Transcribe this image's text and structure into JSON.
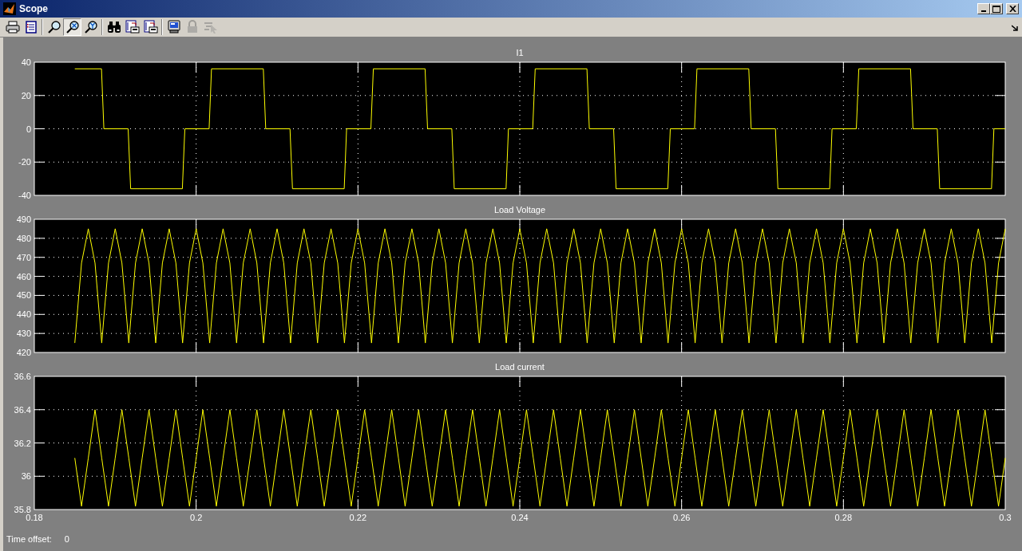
{
  "window": {
    "title": "Scope"
  },
  "toolbar": [
    {
      "kind": "print",
      "selected": false,
      "disabled": false
    },
    {
      "kind": "parameters",
      "selected": false,
      "disabled": false
    },
    {
      "kind": "separator"
    },
    {
      "kind": "zoom",
      "selected": false,
      "disabled": false
    },
    {
      "kind": "zoom-x",
      "selected": true,
      "disabled": false
    },
    {
      "kind": "zoom-y",
      "selected": false,
      "disabled": false
    },
    {
      "kind": "separator"
    },
    {
      "kind": "autoscale",
      "selected": false,
      "disabled": false
    },
    {
      "kind": "save-axes",
      "selected": false,
      "disabled": false
    },
    {
      "kind": "restore-axes",
      "selected": false,
      "disabled": false
    },
    {
      "kind": "separator"
    },
    {
      "kind": "floating",
      "selected": false,
      "disabled": false
    },
    {
      "kind": "lock",
      "selected": false,
      "disabled": true
    },
    {
      "kind": "signal-select",
      "selected": false,
      "disabled": true
    }
  ],
  "plots": [
    {
      "chart_data": {
        "type": "line",
        "title": "I1",
        "xlim": [
          0.18,
          0.3
        ],
        "ylim": [
          -40,
          40
        ],
        "yticks": [
          -40,
          -20,
          0,
          20,
          40
        ],
        "grid": true,
        "x": [
          0.185,
          0.1883,
          0.1886,
          0.1916,
          0.1919,
          0.1983,
          0.1986,
          0.2016,
          0.2019,
          0.2083,
          0.2086,
          0.2116,
          0.2119,
          0.2183,
          0.2186,
          0.2216,
          0.2219,
          0.2283,
          0.2286,
          0.2316,
          0.2319,
          0.2383,
          0.2386,
          0.2416,
          0.2419,
          0.2483,
          0.2486,
          0.2516,
          0.2519,
          0.2583,
          0.2586,
          0.2616,
          0.2619,
          0.2683,
          0.2686,
          0.2716,
          0.2719,
          0.2783,
          0.2786,
          0.2816,
          0.2819,
          0.2883,
          0.2886,
          0.2916,
          0.2919,
          0.2983,
          0.2986,
          0.3
        ],
        "series": [
          {
            "color": "#ffff00",
            "values": [
              36,
              36,
              0,
              0,
              -36,
              -36,
              0,
              0,
              36,
              36,
              0,
              0,
              -36,
              -36,
              0,
              0,
              36,
              36,
              0,
              0,
              -36,
              -36,
              0,
              0,
              36,
              36,
              0,
              0,
              -36,
              -36,
              0,
              0,
              36,
              36,
              0,
              0,
              -36,
              -36,
              0,
              0,
              36,
              36,
              0,
              0,
              -36,
              -36,
              0,
              0
            ]
          }
        ]
      }
    },
    {
      "chart_data": {
        "type": "line",
        "title": "Load Voltage",
        "xlim": [
          0.18,
          0.3
        ],
        "ylim": [
          420,
          490
        ],
        "yticks": [
          420,
          430,
          440,
          450,
          460,
          470,
          480,
          490
        ],
        "grid": true,
        "x": [
          0.185,
          0.18583,
          0.18667,
          0.1875,
          0.18833,
          0.18917,
          0.19,
          0.19083,
          0.19167,
          0.1925,
          0.19333,
          0.19417,
          0.195,
          0.19583,
          0.19667,
          0.1975,
          0.19833,
          0.19917,
          0.2,
          0.20083,
          0.20167,
          0.2025,
          0.20333,
          0.20417,
          0.205,
          0.20583,
          0.20667,
          0.2075,
          0.20833,
          0.20917,
          0.21,
          0.21083,
          0.21167,
          0.2125,
          0.21333,
          0.21417,
          0.215,
          0.21583,
          0.21667,
          0.2175,
          0.21833,
          0.21917,
          0.22,
          0.22083,
          0.22167,
          0.2225,
          0.22333,
          0.22417,
          0.225,
          0.22583,
          0.22667,
          0.2275,
          0.22833,
          0.22917,
          0.23,
          0.23083,
          0.23167,
          0.2325,
          0.23333,
          0.23417,
          0.235,
          0.23583,
          0.23667,
          0.2375,
          0.23833,
          0.23917,
          0.24,
          0.24083,
          0.24167,
          0.2425,
          0.24333,
          0.24417,
          0.245,
          0.24583,
          0.24667,
          0.2475,
          0.24833,
          0.24917,
          0.25,
          0.25083,
          0.25167,
          0.2525,
          0.25333,
          0.25417,
          0.255,
          0.25583,
          0.25667,
          0.2575,
          0.25833,
          0.25917,
          0.26,
          0.26083,
          0.26167,
          0.2625,
          0.26333,
          0.26417,
          0.265,
          0.26583,
          0.26667,
          0.2675,
          0.26833,
          0.26917,
          0.27,
          0.27083,
          0.27167,
          0.2725,
          0.27333,
          0.27417,
          0.275,
          0.27583,
          0.27667,
          0.2775,
          0.27833,
          0.27917,
          0.28,
          0.28083,
          0.28167,
          0.2825,
          0.28333,
          0.28417,
          0.285,
          0.28583,
          0.28667,
          0.2875,
          0.28833,
          0.28917,
          0.29,
          0.29083,
          0.29167,
          0.2925,
          0.29333,
          0.29417,
          0.295,
          0.29583,
          0.29667,
          0.2975,
          0.29833,
          0.29917,
          0.3
        ],
        "series": [
          {
            "color": "#ffff00",
            "values": [
              425,
              467,
              485,
              467,
              425,
              467,
              485,
              467,
              425,
              467,
              485,
              467,
              425,
              467,
              485,
              467,
              425,
              467,
              485,
              467,
              425,
              467,
              485,
              467,
              425,
              467,
              485,
              467,
              425,
              467,
              485,
              467,
              425,
              467,
              485,
              467,
              425,
              467,
              485,
              467,
              425,
              467,
              485,
              467,
              425,
              467,
              485,
              467,
              425,
              467,
              485,
              467,
              425,
              467,
              485,
              467,
              425,
              467,
              485,
              467,
              425,
              467,
              485,
              467,
              425,
              467,
              485,
              467,
              425,
              467,
              485,
              467,
              425,
              467,
              485,
              467,
              425,
              467,
              485,
              467,
              425,
              467,
              485,
              467,
              425,
              467,
              485,
              467,
              425,
              467,
              485,
              467,
              425,
              467,
              485,
              467,
              425,
              467,
              485,
              467,
              425,
              467,
              485,
              467,
              425,
              467,
              485,
              467,
              425,
              467,
              485,
              467,
              425,
              467,
              485,
              467,
              425,
              467,
              485,
              467,
              425,
              467,
              485,
              467,
              425,
              467,
              485,
              467,
              425,
              467,
              485,
              467,
              425,
              467,
              485,
              467,
              425,
              467,
              485
            ]
          }
        ]
      }
    },
    {
      "chart_data": {
        "type": "line",
        "title": "Load current",
        "xlim": [
          0.18,
          0.3
        ],
        "ylim": [
          35.8,
          36.6
        ],
        "yticks": [
          35.8,
          {
            "value": 36,
            "label": "36"
          },
          36.2,
          36.4,
          36.6
        ],
        "grid": true,
        "xticks": [
          0.18,
          0.2,
          0.22,
          0.24,
          0.26,
          0.28,
          0.3
        ],
        "x": [
          0.185,
          0.18583,
          0.18667,
          0.1875,
          0.18833,
          0.18917,
          0.19,
          0.19083,
          0.19167,
          0.1925,
          0.19333,
          0.19417,
          0.195,
          0.19583,
          0.19667,
          0.1975,
          0.19833,
          0.19917,
          0.2,
          0.20083,
          0.20167,
          0.2025,
          0.20333,
          0.20417,
          0.205,
          0.20583,
          0.20667,
          0.2075,
          0.20833,
          0.20917,
          0.21,
          0.21083,
          0.21167,
          0.2125,
          0.21333,
          0.21417,
          0.215,
          0.21583,
          0.21667,
          0.2175,
          0.21833,
          0.21917,
          0.22,
          0.22083,
          0.22167,
          0.2225,
          0.22333,
          0.22417,
          0.225,
          0.22583,
          0.22667,
          0.2275,
          0.22833,
          0.22917,
          0.23,
          0.23083,
          0.23167,
          0.2325,
          0.23333,
          0.23417,
          0.235,
          0.23583,
          0.23667,
          0.2375,
          0.23833,
          0.23917,
          0.24,
          0.24083,
          0.24167,
          0.2425,
          0.24333,
          0.24417,
          0.245,
          0.24583,
          0.24667,
          0.2475,
          0.24833,
          0.24917,
          0.25,
          0.25083,
          0.25167,
          0.2525,
          0.25333,
          0.25417,
          0.255,
          0.25583,
          0.25667,
          0.2575,
          0.25833,
          0.25917,
          0.26,
          0.26083,
          0.26167,
          0.2625,
          0.26333,
          0.26417,
          0.265,
          0.26583,
          0.26667,
          0.2675,
          0.26833,
          0.26917,
          0.27,
          0.27083,
          0.27167,
          0.2725,
          0.27333,
          0.27417,
          0.275,
          0.27583,
          0.27667,
          0.2775,
          0.27833,
          0.27917,
          0.28,
          0.28083,
          0.28167,
          0.2825,
          0.28333,
          0.28417,
          0.285,
          0.28583,
          0.28667,
          0.2875,
          0.28833,
          0.28917,
          0.29,
          0.29083,
          0.29167,
          0.2925,
          0.29333,
          0.29417,
          0.295,
          0.29583,
          0.29667,
          0.2975,
          0.29833,
          0.29917,
          0.3
        ],
        "series": [
          {
            "color": "#ffff00",
            "values": [
              36.11,
              35.82,
              36.11,
              36.4,
              36.11,
              35.82,
              36.11,
              36.4,
              36.11,
              35.82,
              36.11,
              36.4,
              36.11,
              35.82,
              36.11,
              36.4,
              36.11,
              35.82,
              36.11,
              36.4,
              36.11,
              35.82,
              36.11,
              36.4,
              36.11,
              35.82,
              36.11,
              36.4,
              36.11,
              35.82,
              36.11,
              36.4,
              36.11,
              35.82,
              36.11,
              36.4,
              36.11,
              35.82,
              36.11,
              36.4,
              36.11,
              35.82,
              36.11,
              36.4,
              36.11,
              35.82,
              36.11,
              36.4,
              36.11,
              35.82,
              36.11,
              36.4,
              36.11,
              35.82,
              36.11,
              36.4,
              36.11,
              35.82,
              36.11,
              36.4,
              36.11,
              35.82,
              36.11,
              36.4,
              36.11,
              35.82,
              36.11,
              36.4,
              36.11,
              35.82,
              36.11,
              36.4,
              36.11,
              35.82,
              36.11,
              36.4,
              36.11,
              35.82,
              36.11,
              36.4,
              36.11,
              35.82,
              36.11,
              36.4,
              36.11,
              35.82,
              36.11,
              36.4,
              36.11,
              35.82,
              36.11,
              36.4,
              36.11,
              35.82,
              36.11,
              36.4,
              36.11,
              35.82,
              36.11,
              36.4,
              36.11,
              35.82,
              36.11,
              36.4,
              36.11,
              35.82,
              36.11,
              36.4,
              36.11,
              35.82,
              36.11,
              36.4,
              36.11,
              35.82,
              36.11,
              36.4,
              36.11,
              35.82,
              36.11,
              36.4,
              36.11,
              35.82,
              36.11,
              36.4,
              36.11,
              35.82,
              36.11,
              36.4,
              36.11,
              35.82,
              36.11,
              36.4,
              36.11,
              35.82,
              36.11,
              36.4,
              36.11,
              35.82,
              36.11
            ]
          }
        ]
      }
    }
  ],
  "status": {
    "label": "Time offset:",
    "value": "0"
  }
}
